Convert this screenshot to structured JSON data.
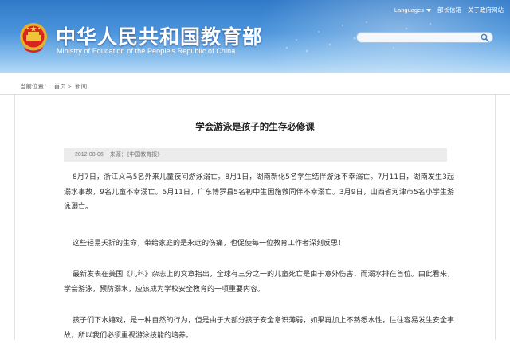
{
  "header": {
    "title": "中华人民共和国教育部",
    "subtitle": "Ministry of Education of the People's Republic of China",
    "links": {
      "languages": "Languages",
      "leader_mailbox": "部长信箱",
      "contact": "关于政府网站"
    },
    "search": {
      "placeholder": ""
    }
  },
  "breadcrumb": {
    "current_label": "当前位置：",
    "home": "首页",
    "sep": ">",
    "section": "新闻"
  },
  "article": {
    "title": "学会游泳是孩子的生存必修课",
    "date": "2012-08-06",
    "source": "来源：《中国教育报》",
    "paragraphs": [
      "8月7日，浙江义乌5名外来儿童夜间游泳溺亡。8月1日，湖南新化5名学生结伴游泳不幸溺亡。7月11日，湖南发生3起溺水事故，9名儿童不幸溺亡。5月11日，广东博罗县5名初中生因施救同伴不幸溺亡。3月9日，山西省河津市5名小学生游泳溺亡。",
      "这些轻易夭折的生命，带给家庭的是永远的伤痛，也促使每一位教育工作者深刻反思！",
      "最新发表在美国《儿科》杂志上的文章指出，全球有三分之一的儿童死亡是由于意外伤害，而溺水排在首位。由此看来，学会游泳，预防溺水，应该成为学校安全教育的一项重要内容。",
      "孩子们下水嬉戏，是一种自然的行为，但是由于大部分孩子安全意识薄弱，如果再加上不熟悉水性，往往容易发生安全事故，所以我们必须重视游泳技能的培养。"
    ]
  },
  "colors": {
    "header_top": "#2f79c8",
    "header_bottom": "#b7daf6",
    "meta_bg": "#ececec"
  },
  "icons": [
    "national-emblem-icon",
    "search-icon",
    "dropdown-triangle-icon"
  ]
}
